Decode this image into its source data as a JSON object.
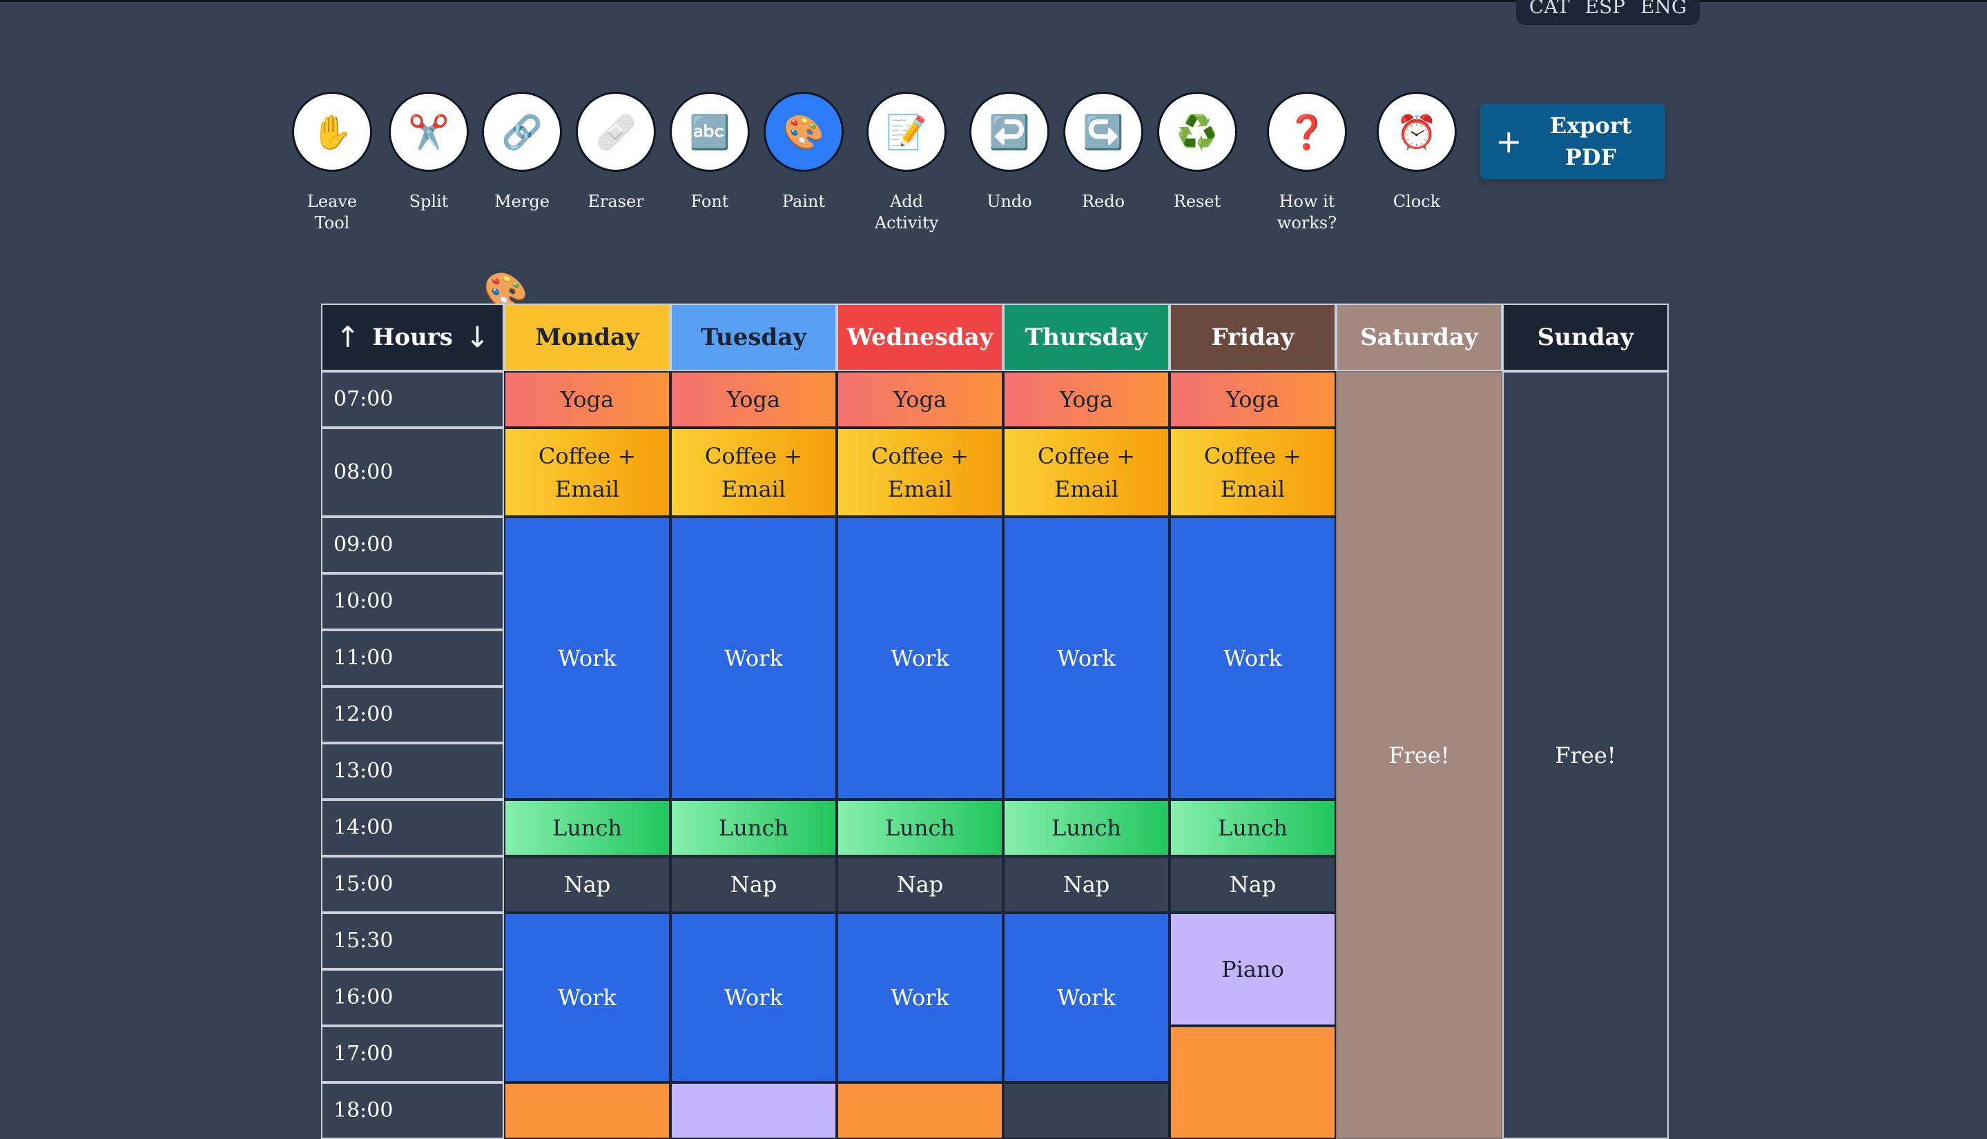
{
  "lang": [
    "CAT",
    "ESP",
    "ENG"
  ],
  "toolbar": [
    {
      "label": [
        "Leave",
        "Tool"
      ],
      "icon": "✋",
      "name": "leave-tool-button",
      "icon_name": "hand-icon"
    },
    {
      "label": [
        "Split"
      ],
      "icon": "✂️",
      "name": "split-button",
      "icon_name": "scissors-icon"
    },
    {
      "label": [
        "Merge"
      ],
      "icon": "🔗",
      "name": "merge-button",
      "icon_name": "link-icon"
    },
    {
      "label": [
        "Eraser"
      ],
      "icon": "🩹",
      "name": "eraser-button",
      "icon_name": "eraser-icon"
    },
    {
      "label": [
        "Font"
      ],
      "icon": "🔤",
      "name": "font-button",
      "icon_name": "abc-icon"
    },
    {
      "label": [
        "Paint"
      ],
      "icon": "🎨",
      "name": "paint-button",
      "icon_name": "palette-icon",
      "active": true
    },
    {
      "label": [
        "Add",
        "Activity"
      ],
      "icon": "📝",
      "name": "add-activity-button",
      "icon_name": "memo-icon"
    },
    {
      "label": [
        "Undo"
      ],
      "icon": "↩️",
      "name": "undo-button",
      "icon_name": "undo-icon"
    },
    {
      "label": [
        "Redo"
      ],
      "icon": "↪️",
      "name": "redo-button",
      "icon_name": "redo-icon"
    },
    {
      "label": [
        "Reset"
      ],
      "icon": "♻️",
      "name": "reset-button",
      "icon_name": "recycle-icon"
    },
    {
      "label": [
        "How it",
        "works?"
      ],
      "icon": "❓",
      "name": "help-button",
      "icon_name": "question-icon"
    },
    {
      "label": [
        "Clock"
      ],
      "icon": "⏰",
      "name": "clock-button",
      "icon_name": "alarm-clock-icon"
    }
  ],
  "export": {
    "plus": "+",
    "label": [
      "Export",
      "PDF"
    ]
  },
  "hours_header": {
    "up": "↑",
    "label": "Hours",
    "down": "↓"
  },
  "days": [
    {
      "name": "Monday",
      "color": "#f9c12b",
      "text": "#1b2230"
    },
    {
      "name": "Tuesday",
      "color": "#5aa0f2",
      "text": "#1b2230"
    },
    {
      "name": "Wednesday",
      "color": "#ee4444",
      "text": "#ffffff"
    },
    {
      "name": "Thursday",
      "color": "#13936a",
      "text": "#ffffff"
    },
    {
      "name": "Friday",
      "color": "#6a4a3f",
      "text": "#ffffff"
    },
    {
      "name": "Saturday",
      "color": "#a38880",
      "text": "#ffffff"
    },
    {
      "name": "Sunday",
      "color": "#1b2433",
      "text": "#ffffff"
    }
  ],
  "hours": [
    "07:00",
    "08:00",
    "09:00",
    "10:00",
    "11:00",
    "12:00",
    "13:00",
    "14:00",
    "15:00",
    "15:30",
    "16:00",
    "17:00",
    "18:00"
  ],
  "activities": {
    "yoga": "Yoga",
    "coffee": "Coffee + Email",
    "work": "Work",
    "lunch": "Lunch",
    "nap": "Nap",
    "piano": "Piano",
    "free": "Free!"
  },
  "colors": {
    "yoga": [
      "#f47171",
      "#fb923c"
    ],
    "coffee": [
      "#fbcf33",
      "#f59e0b"
    ],
    "work": "#2b66e3",
    "lunch": [
      "#86efac",
      "#22c55e"
    ],
    "nap": "#364254",
    "piano": "#c4b5fd",
    "orange": "#fb923c",
    "saturday": "#a38880",
    "sunday": "#364254"
  }
}
